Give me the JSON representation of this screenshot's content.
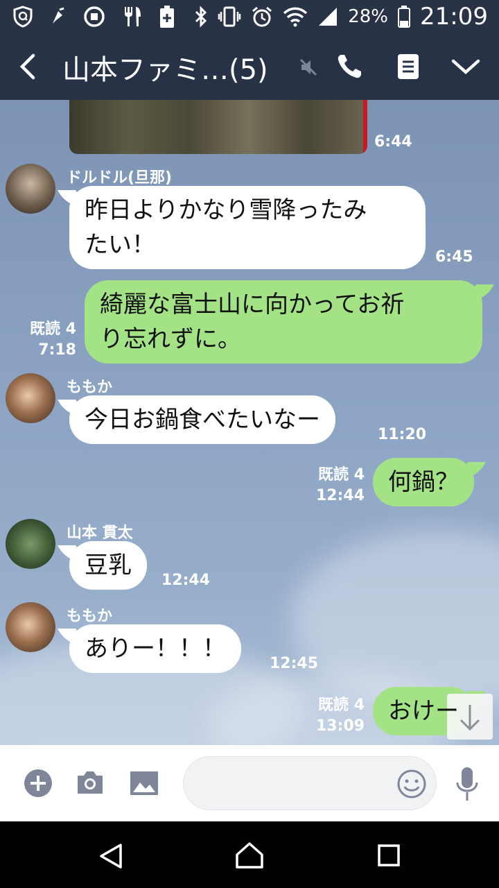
{
  "status_bar": {
    "battery_percent": "28%",
    "time": "21:09",
    "left_icons": [
      "shield-icon",
      "gesture-icon",
      "stop-icon",
      "restaurant-icon",
      "battery-plus-icon"
    ],
    "right_icons": [
      "bluetooth-icon",
      "vibrate-icon",
      "alarm-icon",
      "wifi-icon",
      "signal-icon",
      "battery-icon"
    ]
  },
  "header": {
    "title": "山本ファミ…(5)",
    "background": "#273247",
    "icons": [
      "back-icon",
      "mute-icon",
      "phone-icon",
      "notes-icon",
      "expand-icon"
    ]
  },
  "messages": [
    {
      "type": "photo",
      "direction": "in",
      "time": "6:44"
    },
    {
      "type": "text",
      "direction": "in",
      "sender": "ドルドル(旦那)",
      "lines": [
        "昨日よりかなり雪降ったみ",
        "たい！"
      ],
      "time": "6:45"
    },
    {
      "type": "text",
      "direction": "out",
      "lines": [
        "綺麗な富士山に向かってお祈",
        "り忘れずに。"
      ],
      "read": "既読 4",
      "time": "7:18"
    },
    {
      "type": "text",
      "direction": "in",
      "sender": "ももか",
      "lines": [
        "今日お鍋食べたいなー"
      ],
      "time": "11:20"
    },
    {
      "type": "text",
      "direction": "out",
      "lines": [
        "何鍋？"
      ],
      "read": "既読 4",
      "time": "12:44"
    },
    {
      "type": "text",
      "direction": "in",
      "sender": "山本 貫太",
      "lines": [
        "豆乳"
      ],
      "time": "12:44"
    },
    {
      "type": "text",
      "direction": "in",
      "sender": "ももか",
      "lines": [
        "ありー！！！"
      ],
      "time": "12:45"
    },
    {
      "type": "text",
      "direction": "out",
      "lines": [
        "おけー"
      ],
      "read": "既読 4",
      "time": "13:09"
    }
  ],
  "colors": {
    "outgoing_bubble": "#a3e386",
    "incoming_bubble": "#ffffff",
    "chat_background": "#8aa1c2"
  },
  "input_bar": {
    "placeholder": "",
    "icons": [
      "plus-icon",
      "camera-icon",
      "image-icon",
      "emoji-icon",
      "mic-icon"
    ]
  },
  "nav_bar": {
    "icons": [
      "nav-back-icon",
      "nav-home-icon",
      "nav-recent-icon"
    ]
  }
}
